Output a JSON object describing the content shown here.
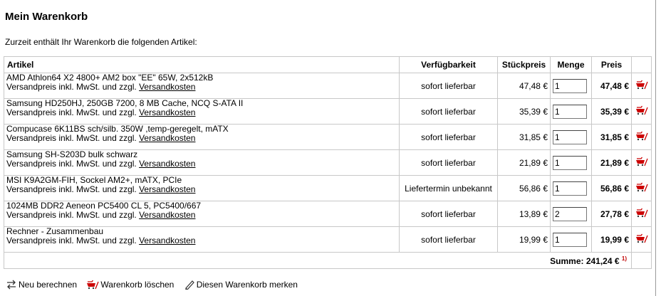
{
  "page": {
    "title": "Mein Warenkorb",
    "intro": "Zurzeit enthält Ihr Warenkorb die folgenden Artikel:"
  },
  "table": {
    "headers": {
      "article": "Artikel",
      "availability": "Verfügbarkeit",
      "unit_price": "Stückpreis",
      "quantity": "Menge",
      "price": "Preis"
    },
    "rows": [
      {
        "name": "AMD Athlon64 X2 4800+ AM2 box \"EE\" 65W, 2x512kB",
        "shipping_text": "Versandpreis inkl. MwSt. und zzgl.",
        "shipping_link": "Versandkosten",
        "availability": "sofort lieferbar",
        "unit_price": "47,48 €",
        "quantity": "1",
        "price": "47,48 €"
      },
      {
        "name": "Samsung HD250HJ, 250GB 7200, 8 MB Cache, NCQ S-ATA II",
        "shipping_text": "Versandpreis inkl. MwSt. und zzgl.",
        "shipping_link": "Versandkosten",
        "availability": "sofort lieferbar",
        "unit_price": "35,39 €",
        "quantity": "1",
        "price": "35,39 €"
      },
      {
        "name": "Compucase 6K11BS sch/silb. 350W ,temp-geregelt, mATX",
        "shipping_text": "Versandpreis inkl. MwSt. und zzgl.",
        "shipping_link": "Versandkosten",
        "availability": "sofort lieferbar",
        "unit_price": "31,85 €",
        "quantity": "1",
        "price": "31,85 €"
      },
      {
        "name": "Samsung SH-S203D bulk schwarz",
        "shipping_text": "Versandpreis inkl. MwSt. und zzgl.",
        "shipping_link": "Versandkosten",
        "availability": "sofort lieferbar",
        "unit_price": "21,89 €",
        "quantity": "1",
        "price": "21,89 €"
      },
      {
        "name": "MSI K9A2GM-FIH, Sockel AM2+, mATX, PCIe",
        "shipping_text": "Versandpreis inkl. MwSt. und zzgl.",
        "shipping_link": "Versandkosten",
        "availability": "Liefertermin unbekannt",
        "unit_price": "56,86 €",
        "quantity": "1",
        "price": "56,86 €"
      },
      {
        "name": "1024MB DDR2 Aeneon PC5400 CL 5, PC5400/667",
        "shipping_text": "Versandpreis inkl. MwSt. und zzgl.",
        "shipping_link": "Versandkosten",
        "availability": "sofort lieferbar",
        "unit_price": "13,89 €",
        "quantity": "2",
        "price": "27,78 €"
      },
      {
        "name": "Rechner - Zusammenbau",
        "shipping_text": "Versandpreis inkl. MwSt. und zzgl.",
        "shipping_link": "Versandkosten",
        "availability": "sofort lieferbar",
        "unit_price": "19,99 €",
        "quantity": "1",
        "price": "19,99 €"
      }
    ],
    "sum_label": "Summe: 241,24 €",
    "sum_note": "1)"
  },
  "actions": {
    "recalculate": {
      "label": "Neu berechnen",
      "icon": "recalculate-arrows-icon"
    },
    "clear_cart": {
      "label": "Warenkorb löschen",
      "icon": "delete-cart-icon"
    },
    "remember_cart": {
      "label": "Diesen Warenkorb merken",
      "icon": "pencil-icon"
    }
  },
  "colors": {
    "delete_icon": "#cc0000",
    "note": "#c00000",
    "border": "#c8c8c8"
  }
}
